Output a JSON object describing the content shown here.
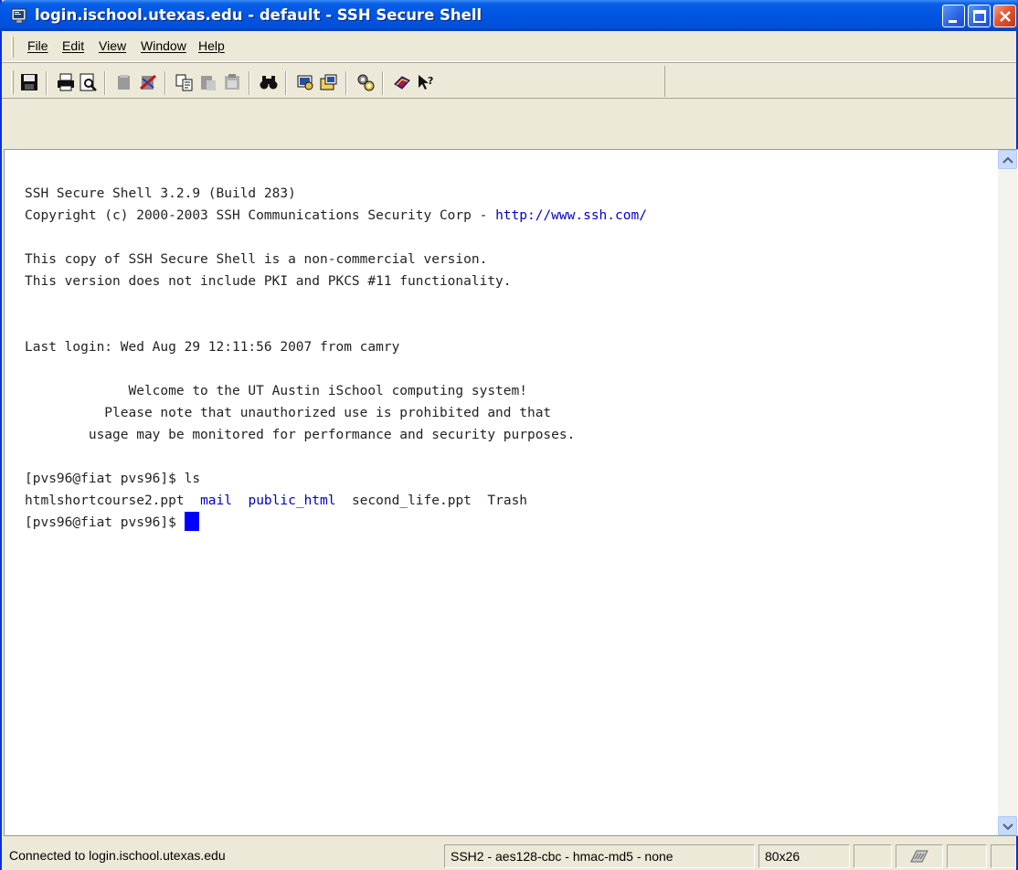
{
  "window": {
    "title": "login.ischool.utexas.edu - default - SSH Secure Shell",
    "title_icon": "ssh-terminal-icon"
  },
  "menu": [
    {
      "hotkey": "F",
      "rest": "ile"
    },
    {
      "hotkey": "E",
      "rest": "dit"
    },
    {
      "hotkey": "V",
      "rest": "iew"
    },
    {
      "hotkey": "W",
      "rest": "indow"
    },
    {
      "hotkey": "H",
      "rest": "elp"
    }
  ],
  "toolbar": {
    "icons": [
      "save-icon",
      "print-icon",
      "print-preview-icon",
      "quick-connect-icon",
      "disconnect-icon",
      "copy-icon",
      "paste-icon",
      "paste-disabled-icon",
      "find-icon",
      "settings-icon",
      "profiles-icon",
      "file-transfer-icon",
      "help-book-icon",
      "whats-this-icon"
    ]
  },
  "terminal": {
    "banner_line1": "SSH Secure Shell 3.2.9 (Build 283)",
    "banner_line2_prefix": "Copyright (c) 2000-2003 SSH Communications Security Corp - ",
    "banner_line2_link": "http://www.ssh.com/",
    "line4": "This copy of SSH Secure Shell is a non-commercial version.",
    "line5": "This version does not include PKI and PKCS #11 functionality.",
    "last_login": "Last login: Wed Aug 29 12:11:56 2007 from camry",
    "motd1": "             Welcome to the UT Austin iSchool computing system!",
    "motd2": "          Please note that unauthorized use is prohibited and that",
    "motd3": "        usage may be monitored for performance and security purposes.",
    "prompt1": "[pvs96@fiat pvs96]$ ls",
    "ls_file1": "htmlshortcourse2.ppt",
    "ls_dir1": "mail",
    "ls_dir2": "public_html",
    "ls_file2": "second_life.ppt",
    "ls_file3": "Trash",
    "prompt2": "[pvs96@fiat pvs96]$ "
  },
  "status": {
    "connected": "Connected to login.ischool.utexas.edu",
    "protocol": "SSH2 - aes128-cbc - hmac-md5 - none",
    "size": "80x26"
  }
}
